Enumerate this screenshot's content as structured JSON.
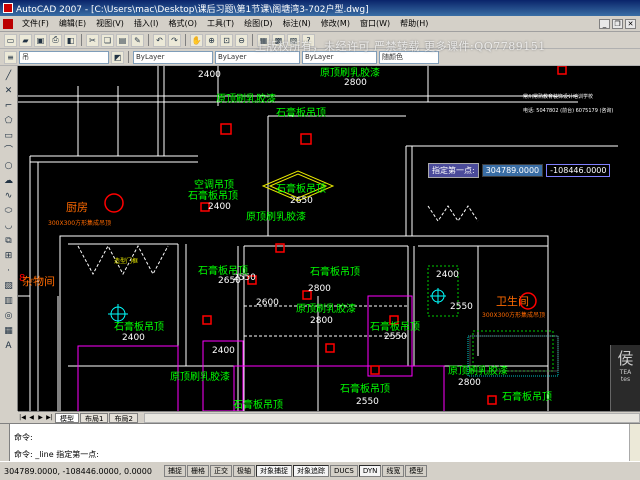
{
  "window": {
    "title": "AutoCAD 2007 - [C:\\Users\\mac\\Desktop\\课后习题\\第1节课\\阁塘湾3-702户型.dwg]"
  },
  "menu": [
    "文件(F)",
    "编辑(E)",
    "视图(V)",
    "插入(I)",
    "格式(O)",
    "工具(T)",
    "绘图(D)",
    "标注(N)",
    "修改(M)",
    "窗口(W)",
    "帮助(H)"
  ],
  "toolbar": {
    "layer_value": "ByLayer",
    "linetype_value": "ByLayer",
    "lineweight_value": "ByLayer",
    "plotstyle_value": "随颜色",
    "layer_name": "吊"
  },
  "watermark": "上版权所有，未经许可 严禁转载  更多课件:QQ7789151",
  "canvas": {
    "labels_white": [
      "2400",
      "2800",
      "2650",
      "2400",
      "2650",
      "2800",
      "2600",
      "2800",
      "2400",
      "2400",
      "2550",
      "2550",
      "2800",
      "2550",
      "2400",
      "2550"
    ],
    "labels_green": {
      "ceiling_paint": "原顶刷乳胶漆",
      "gypsum_ceiling": "石膏板吊顶",
      "aircon_ceiling": "空调吊顶"
    },
    "rooms": {
      "kitchen": "厨房",
      "storage": "杂物间",
      "bathroom": "卫生间"
    },
    "small_notes": {
      "aluminum": "300X300方形集成吊顶",
      "door_frame": "造型门框",
      "brand_line1": "常州常熟教育装饰设计培训学校",
      "brand_line2": "电话: 5047802 (前台)  6075179 (咨询)"
    }
  },
  "prompt": {
    "label": "指定第一点:",
    "x": "304789.0000",
    "y": "-108446.0000"
  },
  "tabs": [
    "模型",
    "布局1",
    "布局2"
  ],
  "command": {
    "line1": "命令:",
    "line2": "命令: _line 指定第一点:"
  },
  "status": {
    "coords": "304789.0000, -108446.0000, 0.0000",
    "buttons": [
      "捕捉",
      "栅格",
      "正交",
      "极轴",
      "对象捕捉",
      "对象追踪",
      "DUCS",
      "DYN",
      "线宽",
      "模型"
    ]
  },
  "colors": {
    "canvas_bg": "#000000",
    "ceiling_text": "#00ff00",
    "room_text": "#ff6a00",
    "wall": "#ffffff",
    "accent": "#ff0000"
  }
}
